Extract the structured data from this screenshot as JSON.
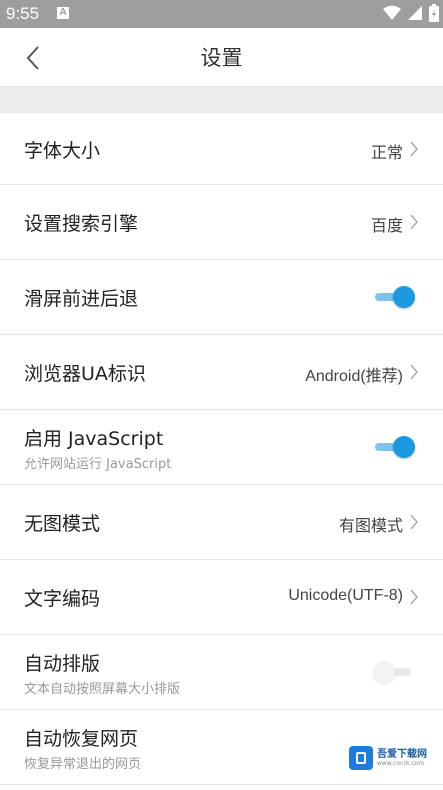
{
  "status_bar": {
    "time": "9:55",
    "notification_icon": "A"
  },
  "app_bar": {
    "title": "设置"
  },
  "settings": [
    {
      "label": "字体大小",
      "value": "正常",
      "type": "select"
    },
    {
      "label": "设置搜索引擎",
      "value": "百度",
      "type": "select"
    },
    {
      "label": "滑屏前进后退",
      "type": "toggle",
      "checked": true
    },
    {
      "label": "浏览器UA标识",
      "value": "Android(推荐)",
      "type": "select"
    },
    {
      "label": "启用 JavaScript",
      "sub": "允许网站运行 JavaScript",
      "type": "toggle",
      "checked": true
    },
    {
      "label": "无图模式",
      "value": "有图模式",
      "type": "select"
    },
    {
      "label": "文字编码",
      "value": "Unicode(UTF-8)",
      "type": "select"
    },
    {
      "label": "自动排版",
      "sub": "文本自动按照屏幕大小排版",
      "type": "toggle",
      "checked": false
    },
    {
      "label": "自动恢复网页",
      "sub": "恢复异常退出的网页",
      "type": "none"
    }
  ],
  "watermark": {
    "name": "吾爱下载网",
    "url": "www.cncrk.com"
  },
  "colors": {
    "accent": "#1a98e0",
    "status_bar": "#9e9e9e"
  }
}
